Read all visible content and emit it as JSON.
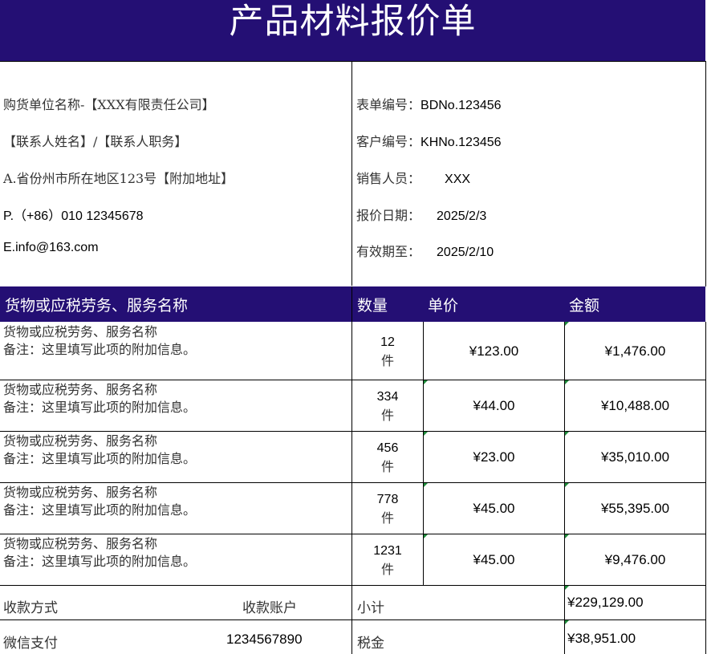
{
  "title": "产品材料报价单",
  "buyer": {
    "company": "购货单位名称-【XXX有限责任公司】",
    "contact": "【联系人姓名】/【联系人职务】",
    "address": "A.省份州市所在地区123号【附加地址】",
    "phone": "P.（+86）010 12345678",
    "email": "E.info@163.com"
  },
  "meta": {
    "form_no_label": "表单编号：",
    "form_no": "BDNo.123456",
    "customer_no_label": "客户编号：",
    "customer_no": "KHNo.123456",
    "sales_label": "销售人员：",
    "sales": "XXX",
    "date_label": "报价日期：",
    "date": "2025/2/3",
    "valid_label": "有效期至：",
    "valid": "2025/2/10"
  },
  "table": {
    "headers": [
      "货物或应税劳务、服务名称",
      "数量",
      "单价",
      "金额"
    ],
    "rows": [
      {
        "name": "货物或应税劳务、服务名称",
        "note": "备注：这里填写此项的附加信息。",
        "qty": "12",
        "unit": "件",
        "price": "¥123.00",
        "amount": "¥1,476.00"
      },
      {
        "name": "货物或应税劳务、服务名称",
        "note": "备注：这里填写此项的附加信息。",
        "qty": "334",
        "unit": "件",
        "price": "¥44.00",
        "amount": "¥10,488.00"
      },
      {
        "name": "货物或应税劳务、服务名称",
        "note": "备注：这里填写此项的附加信息。",
        "qty": "456",
        "unit": "件",
        "price": "¥23.00",
        "amount": "¥35,010.00"
      },
      {
        "name": "货物或应税劳务、服务名称",
        "note": "备注：这里填写此项的附加信息。",
        "qty": "778",
        "unit": "件",
        "price": "¥45.00",
        "amount": "¥55,395.00"
      },
      {
        "name": "货物或应税劳务、服务名称",
        "note": "备注：这里填写此项的附加信息。",
        "qty": "1231",
        "unit": "件",
        "price": "¥45.00",
        "amount": "¥9,476.00"
      }
    ]
  },
  "footer": {
    "pay_method_label": "收款方式",
    "account_label": "收款账户",
    "subtotal_label": "小计",
    "subtotal": "¥229,129.00",
    "pay_method": "微信支付",
    "account": "1234567890",
    "tax_label": "税金",
    "tax": "¥38,951.00"
  },
  "colors": {
    "header_bg": "#240f74",
    "header_text": "#ffffff",
    "cell_marker": "#1e8c3a"
  }
}
